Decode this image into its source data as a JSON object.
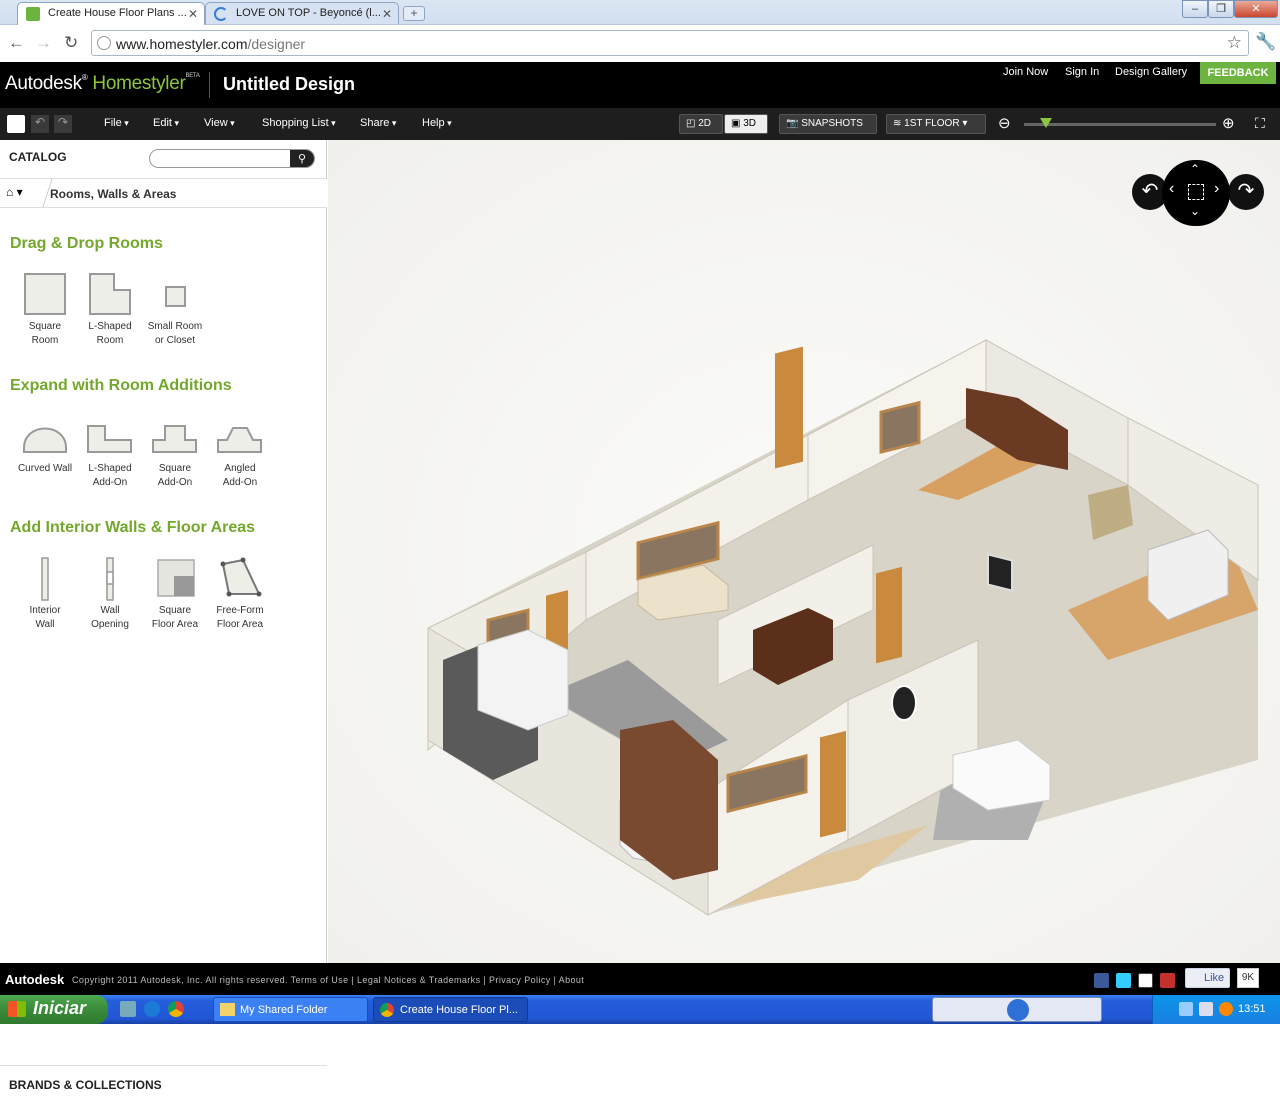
{
  "browser": {
    "tabs": [
      {
        "title": "Create House Floor Plans ...",
        "active": true
      },
      {
        "title": "LOVE ON TOP - Beyoncé (l...",
        "active": false
      }
    ],
    "url_host": "www.homestyler.com",
    "url_path": "/designer",
    "new_tab": "+",
    "window_buttons": [
      "minimize",
      "restore",
      "close"
    ]
  },
  "app": {
    "brand_autodesk": "Autodesk",
    "brand_homestyler": "Homestyler",
    "brand_beta": "BETA",
    "design_title": "Untitled Design",
    "links": {
      "join": "Join Now",
      "signin": "Sign In",
      "gallery": "Design Gallery",
      "feedback": "FEEDBACK"
    }
  },
  "menubar": {
    "menus": [
      "File",
      "Edit",
      "View",
      "Shopping List",
      "Share",
      "Help"
    ],
    "view_2d": "2D",
    "view_3d": "3D",
    "snapshots": "SNAPSHOTS",
    "floor": "1ST FLOOR",
    "zoom_level": 0.05
  },
  "catalog": {
    "label": "CATALOG",
    "search_placeholder": "",
    "breadcrumb": "Rooms, Walls & Areas",
    "sections": [
      {
        "title": "Drag & Drop Rooms",
        "items": [
          [
            "Square",
            "Room"
          ],
          [
            "L-Shaped",
            "Room"
          ],
          [
            "Small Room",
            "or Closet"
          ]
        ]
      },
      {
        "title": "Expand with Room Additions",
        "items": [
          [
            "Curved Wall",
            ""
          ],
          [
            "L-Shaped",
            "Add-On"
          ],
          [
            "Square",
            "Add-On"
          ],
          [
            "Angled",
            "Add-On"
          ]
        ]
      },
      {
        "title": "Add Interior Walls & Floor Areas",
        "items": [
          [
            "Interior",
            "Wall"
          ],
          [
            "Wall",
            "Opening"
          ],
          [
            "Square",
            "Floor Area"
          ],
          [
            "Free-Form",
            "Floor Area"
          ]
        ]
      }
    ],
    "brands": "BRANDS & COLLECTIONS"
  },
  "footer": {
    "autodesk": "Autodesk",
    "copyright": "Copyright 2011 Autodesk, Inc. All rights reserved. Terms of Use | Legal Notices & Trademarks | Privacy Policy | About",
    "like": "Like",
    "like_count": "9K"
  },
  "taskbar": {
    "start": "Iniciar",
    "tasks": [
      "My Shared Folder",
      "Create House Floor Pl..."
    ],
    "clock": "13:51"
  },
  "colors": {
    "brand_green": "#74a82c",
    "feedback_green": "#6db33f",
    "header_black": "#000000",
    "menubar": "#1e1e1e"
  }
}
